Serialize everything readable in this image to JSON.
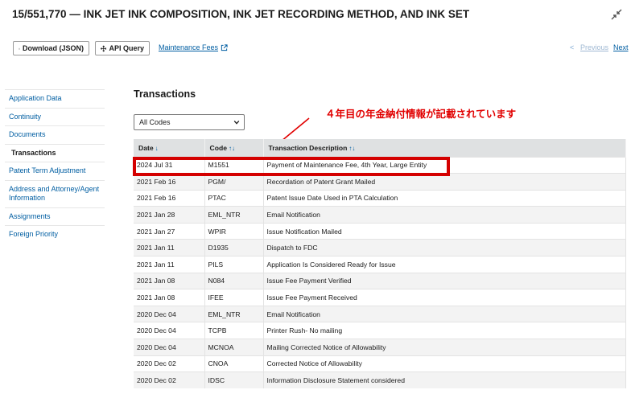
{
  "header": {
    "title": "15/551,770 — INK JET INK COMPOSITION, INK JET RECORDING METHOD, AND INK SET"
  },
  "toolbar": {
    "download_label": "Download (JSON)",
    "api_label": "API Query",
    "maintenance_label": "Maintenance Fees"
  },
  "pager": {
    "prev_arrow": "<",
    "prev_label": "Previous",
    "next_label": "Next"
  },
  "sidebar": {
    "items": [
      {
        "label": "Application Data"
      },
      {
        "label": "Continuity"
      },
      {
        "label": "Documents"
      },
      {
        "label": "Transactions"
      },
      {
        "label": "Patent Term Adjustment"
      },
      {
        "label": "Address and Attorney/Agent Information"
      },
      {
        "label": "Assignments"
      },
      {
        "label": "Foreign Priority"
      }
    ]
  },
  "main": {
    "section_title": "Transactions",
    "filter_value": "All Codes",
    "annotation": "４年目の年金納付情報が記載されています",
    "columns": [
      "Date",
      "Code",
      "Transaction Description"
    ],
    "rows": [
      [
        "2024 Jul 31",
        "M1551",
        "Payment of Maintenance Fee, 4th Year, Large Entity"
      ],
      [
        "2021 Feb 16",
        "PGM/",
        "Recordation of Patent Grant Mailed"
      ],
      [
        "2021 Feb 16",
        "PTAC",
        "Patent Issue Date Used in PTA Calculation"
      ],
      [
        "2021 Jan 28",
        "EML_NTR",
        "Email Notification"
      ],
      [
        "2021 Jan 27",
        "WPIR",
        "Issue Notification Mailed"
      ],
      [
        "2021 Jan 11",
        "D1935",
        "Dispatch to FDC"
      ],
      [
        "2021 Jan 11",
        "PILS",
        "Application Is Considered Ready for Issue"
      ],
      [
        "2021 Jan 08",
        "N084",
        "Issue Fee Payment Verified"
      ],
      [
        "2021 Jan 08",
        "IFEE",
        "Issue Fee Payment Received"
      ],
      [
        "2020 Dec 04",
        "EML_NTR",
        "Email Notification"
      ],
      [
        "2020 Dec 04",
        "TCPB",
        "Printer Rush- No mailing"
      ],
      [
        "2020 Dec 04",
        "MCNOA",
        "Mailing Corrected Notice of Allowability"
      ],
      [
        "2020 Dec 02",
        "CNOA",
        "Corrected Notice of Allowability"
      ],
      [
        "2020 Dec 02",
        "IDSC",
        "Information Disclosure Statement considered"
      ]
    ]
  },
  "colors": {
    "link": "#005ea2",
    "annotation": "#e10000",
    "header_bg": "#dfe1e2"
  }
}
